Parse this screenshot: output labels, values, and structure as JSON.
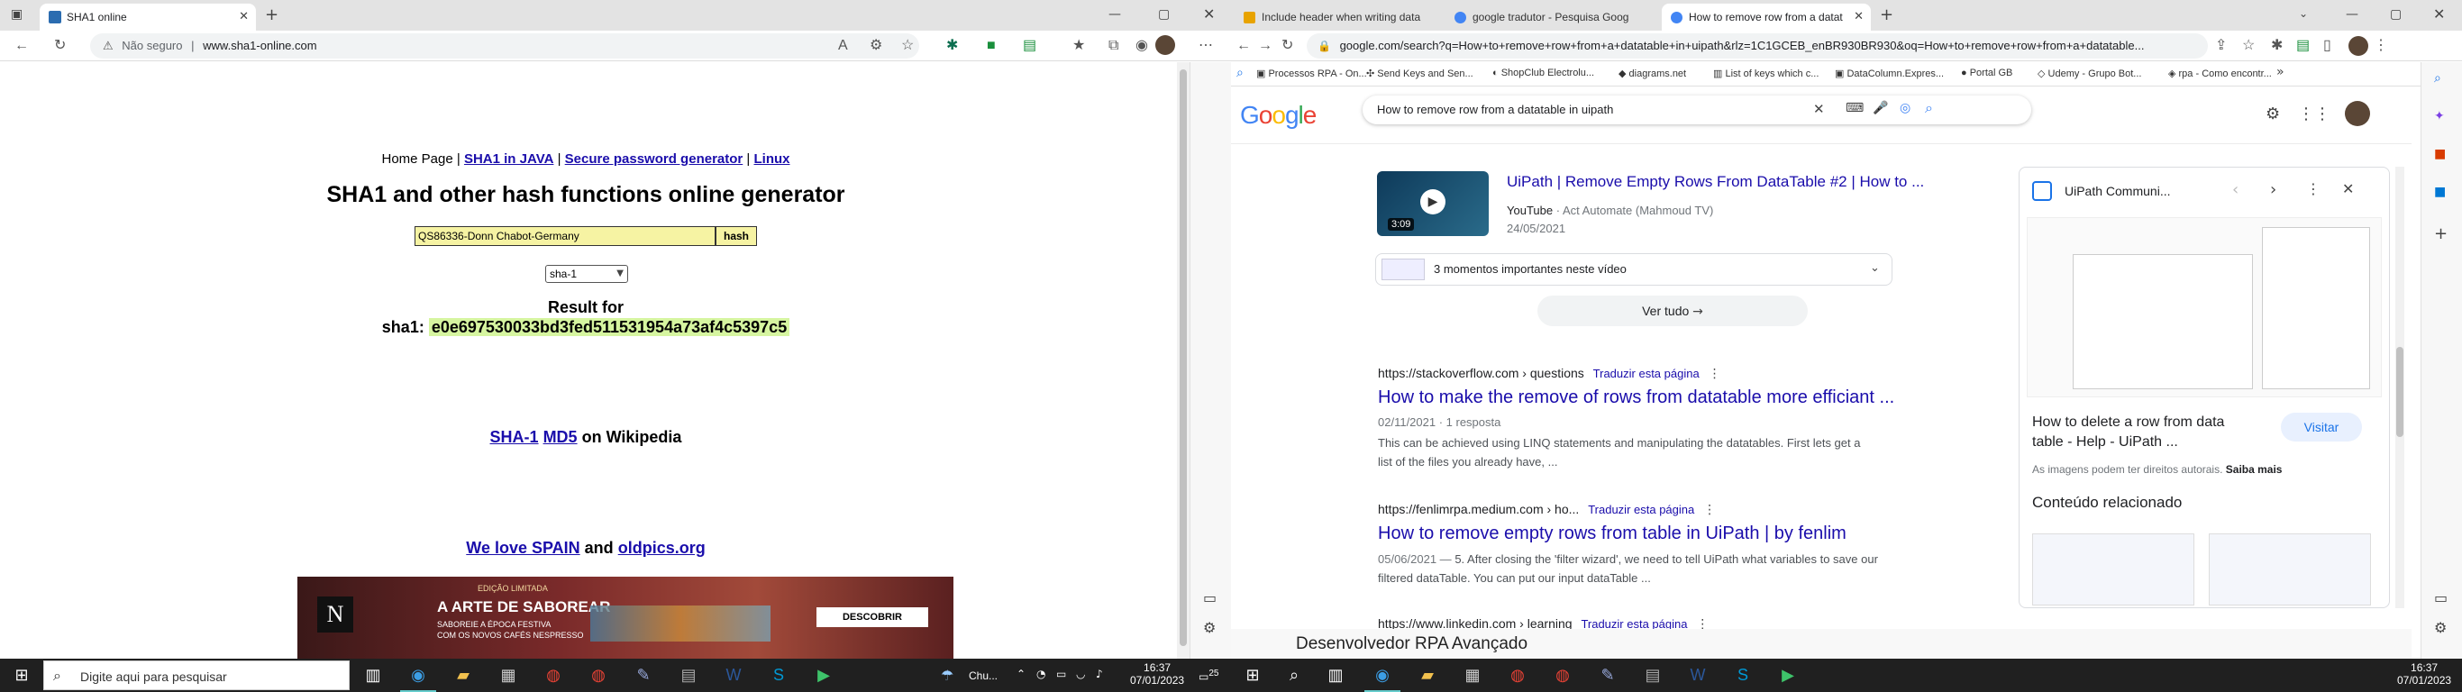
{
  "left": {
    "tab_title": "SHA1 online",
    "address_security": "Não seguro",
    "address_url": "www.sha1-online.com",
    "nav": {
      "home": "Home Page",
      "sep": "|",
      "java": "SHA1 in JAVA",
      "pwd": "Secure password generator",
      "linux": "Linux"
    },
    "heading": "SHA1 and other hash functions online generator",
    "input_value": "QS86336-Donn Chabot-Germany",
    "hash_button": "hash",
    "select_value": "sha-1",
    "result_label": "Result for",
    "result_prefix": "sha1:",
    "result_hash": "e0e697530033bd3fed511531954a73af4c5397c5",
    "wiki_sha1": "SHA-1",
    "wiki_md5": "MD5",
    "wiki_suffix": "on Wikipedia",
    "love_prefix": "We love SPAIN",
    "love_and": "and",
    "love_link": "oldpics.org",
    "ad": {
      "badge": "EDIÇÃO LIMITADA",
      "title": "A ARTE DE SABOREAR",
      "line1": "SABOREIE A ÉPOCA FESTIVA",
      "line2": "COM OS NOVOS CAFÉS NESPRESSO",
      "cta": "DESCOBRIR",
      "logo": "N"
    }
  },
  "right": {
    "tabs": [
      "Include header when writing data",
      "google tradutor - Pesquisa Goog",
      "How to remove row from a datat"
    ],
    "address_url": "google.com/search?q=How+to+remove+row+from+a+datatable+in+uipath&rlz=1C1GCEB_enBR930BR930&oq=How+to+remove+row+from+a+datatable...",
    "bookmarks": [
      "Processos RPA - On...",
      "Send Keys and Sen...",
      "ShopClub Electrolu...",
      "diagrams.net",
      "List of keys which c...",
      "DataColumn.Expres...",
      "Portal GB",
      "Udemy - Grupo Bot...",
      "rpa - Como encontr..."
    ],
    "search_query": "How to remove row from a datatable in uipath",
    "google_logo": [
      "G",
      "o",
      "o",
      "g",
      "l",
      "e"
    ],
    "google_colors": [
      "#4285f4",
      "#ea4335",
      "#fbbc05",
      "#4285f4",
      "#34a853",
      "#ea4335"
    ],
    "video": {
      "title": "UiPath | Remove Empty Rows From DataTable #2 | How to ...",
      "source": "YouTube",
      "channel": "· Act Automate (Mahmoud TV)",
      "date": "24/05/2021",
      "duration": "3:09",
      "moments": "3 momentos importantes neste vídeo",
      "see_all": "Ver tudo"
    },
    "results": [
      {
        "url": "https://stackoverflow.com › questions",
        "translate": "Traduzir esta página",
        "title": "How to make the remove of rows from datatable more efficiant ...",
        "meta": "02/11/2021 · 1 resposta",
        "snippet1": "This can be achieved using LINQ statements and manipulating the datatables. First lets get a",
        "snippet2": "list of the files you already have, ..."
      },
      {
        "url": "https://fenlimrpa.medium.com › ho...",
        "translate": "Traduzir esta página",
        "title": "How to remove empty rows from table in UiPath | by fenlim",
        "meta": "05/06/2021 —",
        "snippet1": "5. After closing the 'filter wizard', we need to tell UiPath what variables to save our",
        "snippet2": "filtered dataTable. You can put our input dataTable ..."
      },
      {
        "url": "https://www.linkedin.com › learning",
        "translate": "Traduzir esta página"
      }
    ],
    "panel": {
      "title": "UiPath Communi...",
      "desc_title": "How to delete a row from data table - Help - UiPath ...",
      "visit": "Visitar",
      "rights": "As imagens podem ter direitos autorais.",
      "more": "Saiba mais",
      "related": "Conteúdo relacionado"
    },
    "below_text": "Desenvolvedor RPA Avançado"
  },
  "taskbar": {
    "search_placeholder": "Digite aqui para pesquisar",
    "weather": "Chu...",
    "time_left": "16:37",
    "date_left": "07/01/2023",
    "time_right": "16:37",
    "date_right": "07/01/2023",
    "notif_count": "25"
  }
}
